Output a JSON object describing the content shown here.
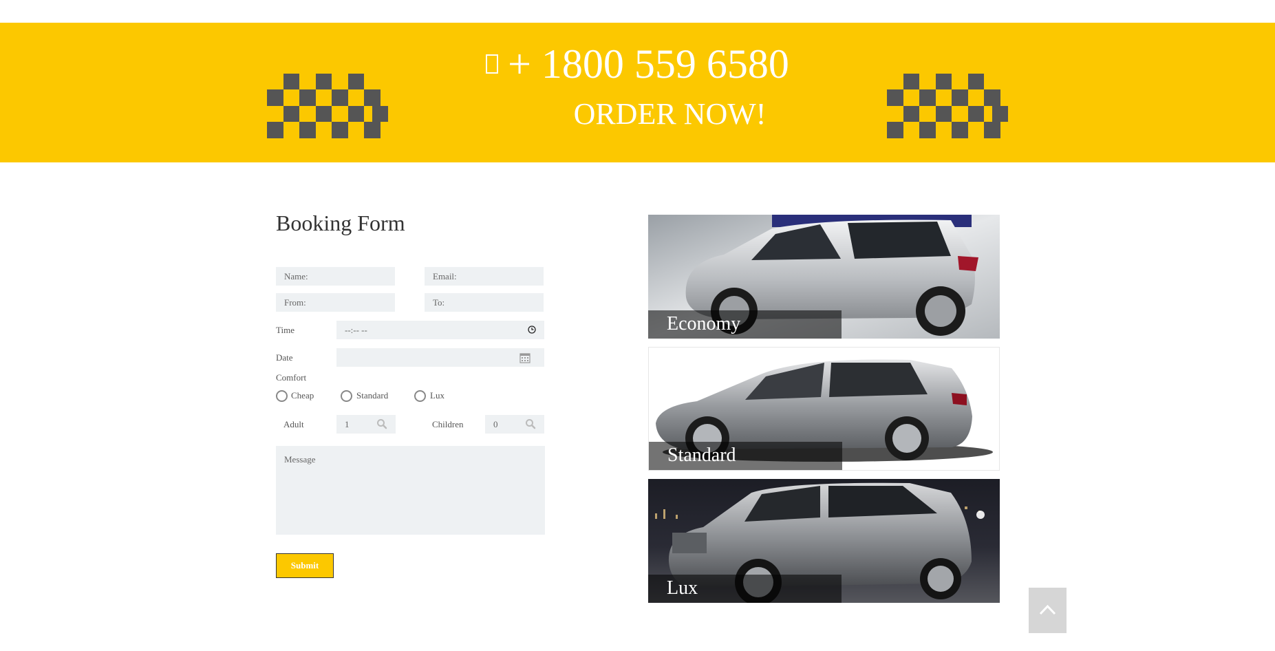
{
  "banner": {
    "phone": "+ 1800 559 6580",
    "cta": "ORDER NOW!",
    "phone_icon": "phone-icon",
    "background": "#fcc800"
  },
  "form": {
    "title": "Booking Form",
    "name_placeholder": "Name:",
    "email_placeholder": "Email:",
    "from_placeholder": "From:",
    "to_placeholder": "To:",
    "time_label": "Time",
    "time_value": "--:-- --",
    "date_label": "Date",
    "date_value": "",
    "comfort_label": "Comfort",
    "comfort_options": [
      "Cheap",
      "Standard",
      "Lux"
    ],
    "adult_label": "Adult",
    "adult_value": "1",
    "children_label": "Children",
    "children_value": "0",
    "message_placeholder": "Message",
    "submit_label": "Submit"
  },
  "cars": [
    {
      "label": "Economy"
    },
    {
      "label": "Standard"
    },
    {
      "label": "Lux"
    }
  ],
  "scroll_top_icon": "chevron-up-icon"
}
